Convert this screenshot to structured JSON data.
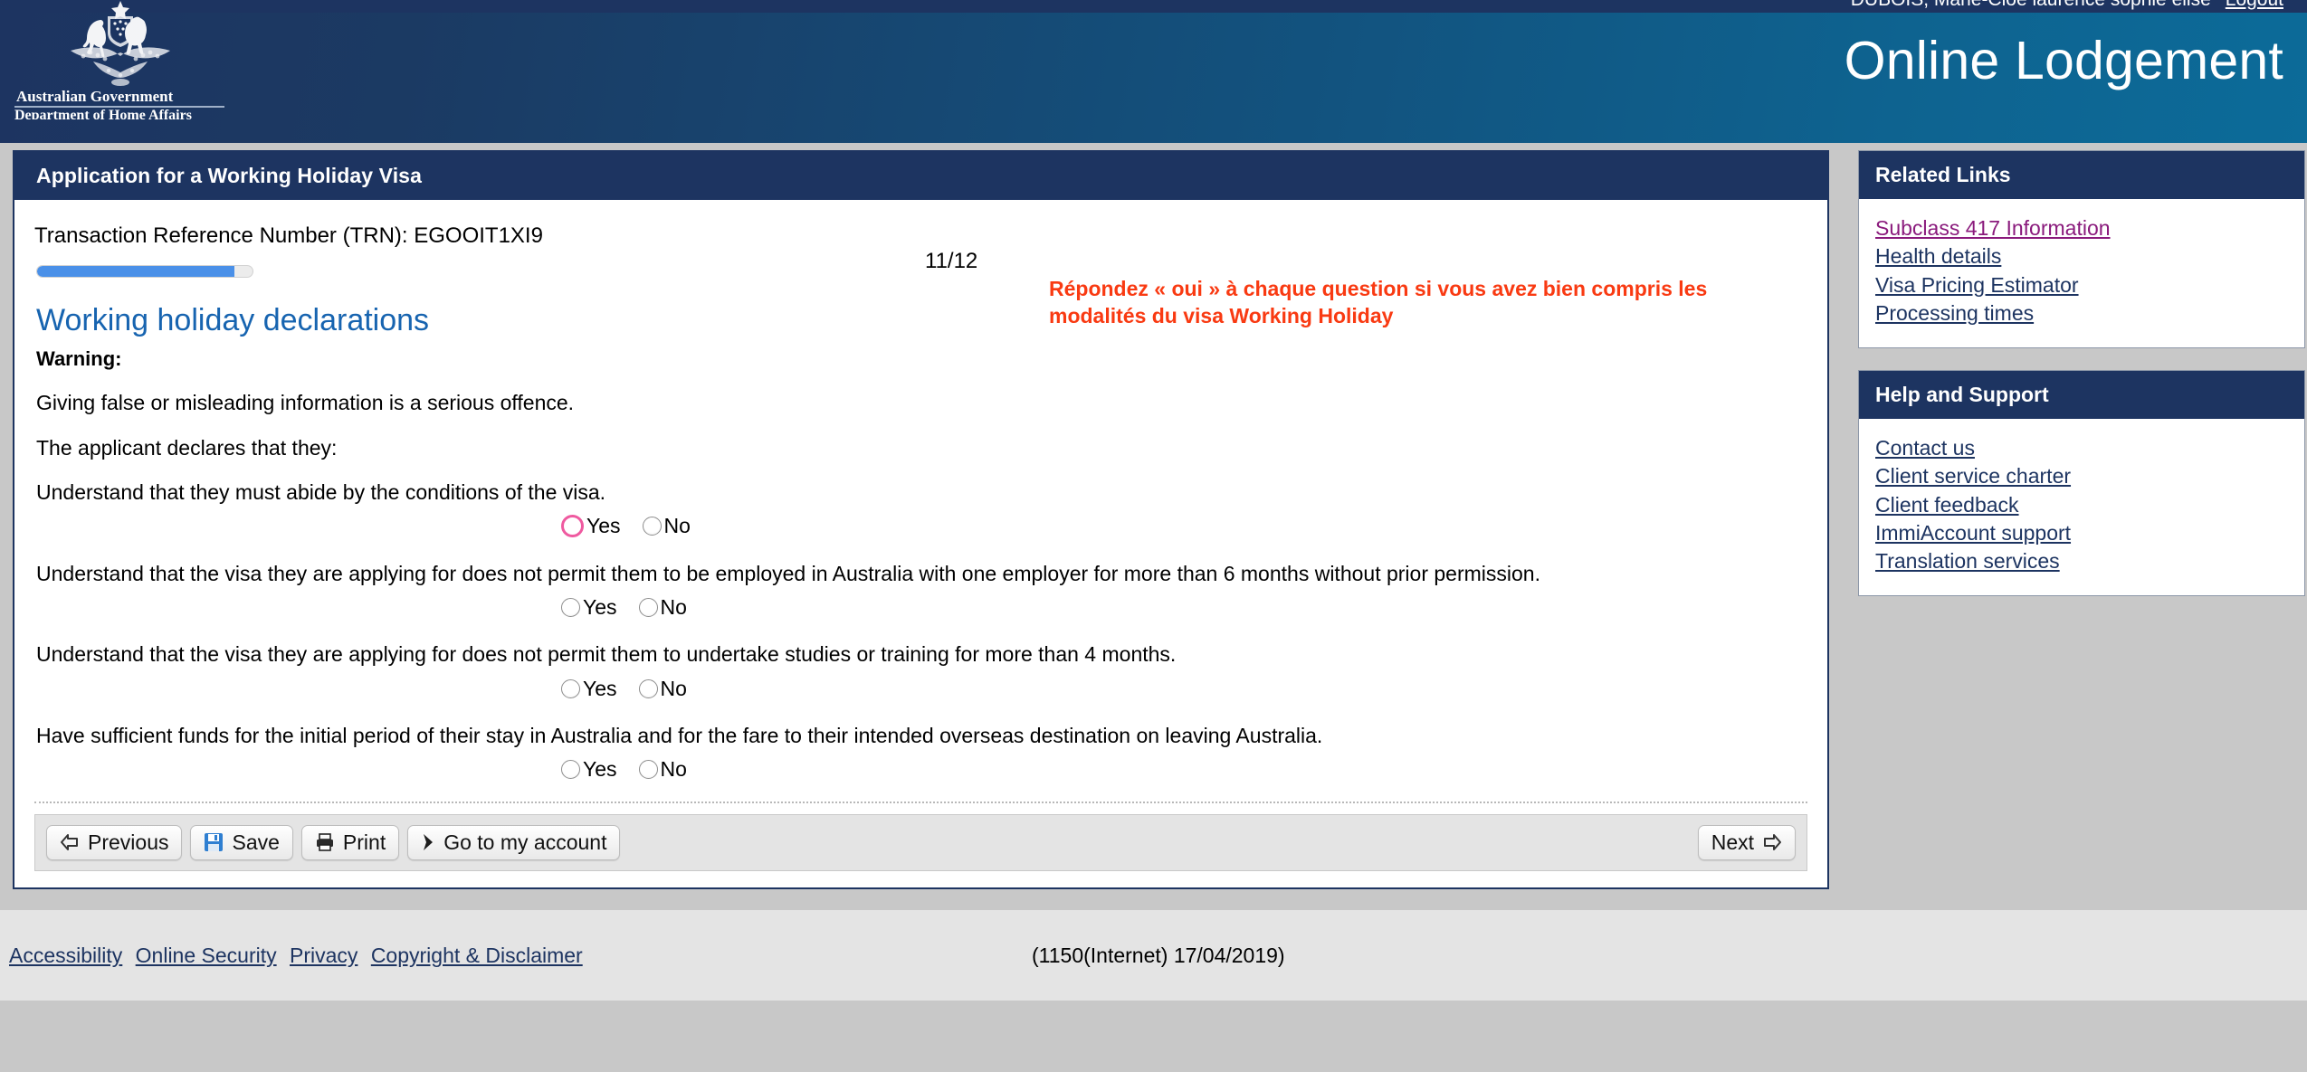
{
  "header": {
    "user_name": "DUBOIS, Marie-Cloe laurence sophie elise",
    "logout_label": "Logout",
    "crest_line1": "Australian Government",
    "crest_line2": "Department of Home Affairs",
    "site_title": "Online Lodgement",
    "colors": {
      "navy": "#1d3461",
      "teal": "#0c6b99"
    }
  },
  "form": {
    "card_title": "Application for a Working Holiday Visa",
    "trn_line": "Transaction Reference Number (TRN): EGOOIT1XI9",
    "progress": {
      "counter": "11/12",
      "current": 11,
      "total": 12,
      "percent": 91.6,
      "fill_color": "#4a90e8"
    },
    "section_heading": "Working holiday declarations",
    "warning_label": "Warning:",
    "paragraph_1": "Giving false or misleading information is a serious offence.",
    "paragraph_2": "The applicant declares that they:",
    "annotation": {
      "text": "Répondez « oui » à chaque question si vous avez bien compris les modalités du visa Working Holiday",
      "color": "#f93a12"
    },
    "declarations": [
      {
        "text": "Understand that they must abide by the conditions of the visa.",
        "yes_label": "Yes",
        "no_label": "No",
        "selected": "",
        "focused": "yes"
      },
      {
        "text": "Understand that the visa they are applying for does not permit them to be employed in Australia with one employer for more than 6 months without prior permission.",
        "yes_label": "Yes",
        "no_label": "No",
        "selected": "",
        "focused": ""
      },
      {
        "text": "Understand that the visa they are applying for does not permit them to undertake studies or training for more than 4 months.",
        "yes_label": "Yes",
        "no_label": "No",
        "selected": "",
        "focused": ""
      },
      {
        "text": "Have sufficient funds for the initial period of their stay in Australia and for the fare to their intended overseas destination on leaving Australia.",
        "yes_label": "Yes",
        "no_label": "No",
        "selected": "",
        "focused": ""
      }
    ],
    "toolbar": {
      "previous_label": "Previous",
      "save_label": "Save",
      "print_label": "Print",
      "account_label": "Go to my account",
      "next_label": "Next"
    }
  },
  "sidebar": {
    "related_links": {
      "title": "Related Links",
      "items": [
        {
          "label": "Subclass 417 Information",
          "visited": true
        },
        {
          "label": "Health details",
          "visited": false
        },
        {
          "label": "Visa Pricing Estimator",
          "visited": false
        },
        {
          "label": "Processing times",
          "visited": false
        }
      ]
    },
    "help_support": {
      "title": "Help and Support",
      "items": [
        {
          "label": "Contact us"
        },
        {
          "label": "Client service charter"
        },
        {
          "label": "Client feedback"
        },
        {
          "label": "ImmiAccount support"
        },
        {
          "label": "Translation services"
        }
      ]
    }
  },
  "footer": {
    "links": [
      "Accessibility",
      "Online Security",
      "Privacy",
      "Copyright & Disclaimer"
    ],
    "version": "(1150(Internet) 17/04/2019)"
  }
}
